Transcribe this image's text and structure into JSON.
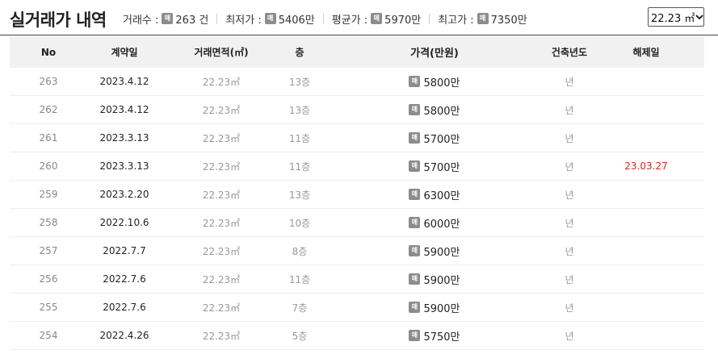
{
  "title": "실거래가 내역",
  "stats": [
    {
      "label": "거래수 :",
      "icon": "매",
      "value": "263 건"
    },
    {
      "label": "최저가 :",
      "icon": "매",
      "value": "5406만"
    },
    {
      "label": "평균가 :",
      "icon": "매",
      "value": "5970만"
    },
    {
      "label": "최고가 :",
      "icon": "매",
      "value": "7350만"
    }
  ],
  "area_select": {
    "selected": "22.23 ㎡"
  },
  "table": {
    "headers": [
      "No",
      "계약일",
      "거래면적(㎡)",
      "층",
      "가격(만원)",
      "건축년도",
      "해제일"
    ],
    "price_icon": "매",
    "rows": [
      {
        "no": "263",
        "date": "2023.4.12",
        "area": "22.23㎡",
        "floor": "13층",
        "price": "5800만",
        "year": "년",
        "cancel": ""
      },
      {
        "no": "262",
        "date": "2023.4.12",
        "area": "22.23㎡",
        "floor": "13층",
        "price": "5800만",
        "year": "년",
        "cancel": ""
      },
      {
        "no": "261",
        "date": "2023.3.13",
        "area": "22.23㎡",
        "floor": "11층",
        "price": "5700만",
        "year": "년",
        "cancel": ""
      },
      {
        "no": "260",
        "date": "2023.3.13",
        "area": "22.23㎡",
        "floor": "11층",
        "price": "5700만",
        "year": "년",
        "cancel": "23.03.27"
      },
      {
        "no": "259",
        "date": "2023.2.20",
        "area": "22.23㎡",
        "floor": "13층",
        "price": "6300만",
        "year": "년",
        "cancel": ""
      },
      {
        "no": "258",
        "date": "2022.10.6",
        "area": "22.23㎡",
        "floor": "10층",
        "price": "6000만",
        "year": "년",
        "cancel": ""
      },
      {
        "no": "257",
        "date": "2022.7.7",
        "area": "22.23㎡",
        "floor": "8층",
        "price": "5900만",
        "year": "년",
        "cancel": ""
      },
      {
        "no": "256",
        "date": "2022.7.6",
        "area": "22.23㎡",
        "floor": "11층",
        "price": "5900만",
        "year": "년",
        "cancel": ""
      },
      {
        "no": "255",
        "date": "2022.7.6",
        "area": "22.23㎡",
        "floor": "7층",
        "price": "5900만",
        "year": "년",
        "cancel": ""
      },
      {
        "no": "254",
        "date": "2022.4.26",
        "area": "22.23㎡",
        "floor": "5층",
        "price": "5750만",
        "year": "년",
        "cancel": ""
      }
    ]
  },
  "colors": {
    "cancel_red": "#e02020",
    "header_bg": "#f1f1f1",
    "icon_gray": "#8c8c8c"
  }
}
